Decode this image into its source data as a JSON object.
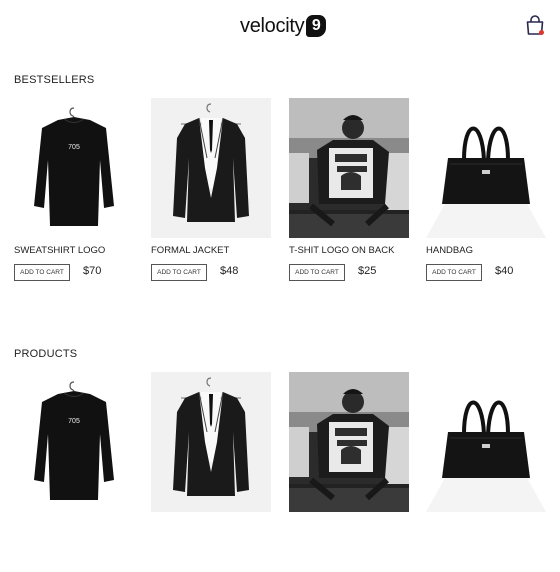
{
  "brand": {
    "name": "velocity",
    "badge": "9"
  },
  "cart_icon": "shopping-bag-icon",
  "colors": {
    "accent_dot": "#e0352b",
    "text": "#222222"
  },
  "sections": [
    {
      "title": "BESTSELLERS",
      "products": [
        {
          "name": "SWEATSHIRT LOGO",
          "price": "$70",
          "button": "ADD TO CART",
          "image": "sweatshirt-image",
          "shirt_print": "705"
        },
        {
          "name": "FORMAL JACKET",
          "price": "$48",
          "button": "ADD TO CART",
          "image": "jacket-image"
        },
        {
          "name": "T-SHIT LOGO ON BACK",
          "price": "$25",
          "button": "ADD TO CART",
          "image": "tshirt-photo"
        },
        {
          "name": "HANDBAG",
          "price": "$40",
          "button": "ADD TO CART",
          "image": "handbag-image"
        }
      ]
    },
    {
      "title": "PRODUCTS",
      "products": [
        {
          "image": "sweatshirt-image",
          "shirt_print": "705"
        },
        {
          "image": "jacket-image"
        },
        {
          "image": "tshirt-photo"
        },
        {
          "image": "handbag-image"
        }
      ]
    }
  ]
}
